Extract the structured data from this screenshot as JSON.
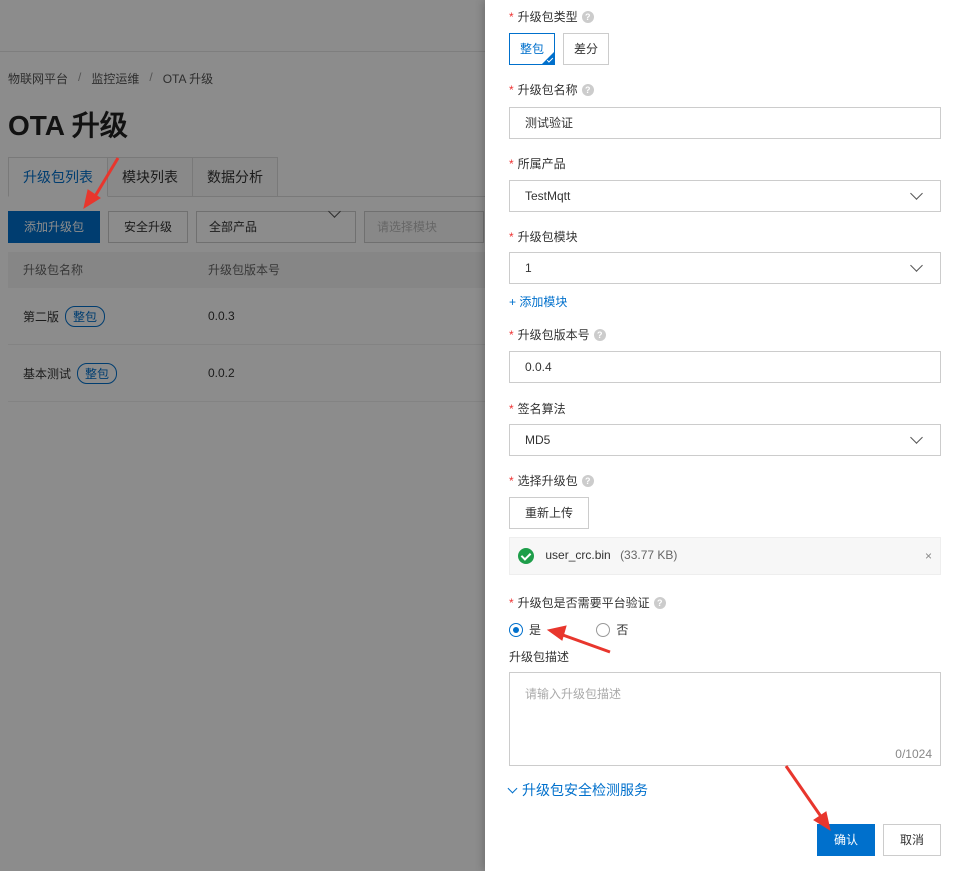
{
  "breadcrumb": [
    "物联网平台",
    "监控运维",
    "OTA 升级"
  ],
  "page_title": "OTA 升级",
  "tabs": [
    "升级包列表",
    "模块列表",
    "数据分析"
  ],
  "toolbar": {
    "add_label": "添加升级包",
    "secure_label": "安全升级",
    "product_select": "全部产品",
    "module_select": "请选择模块"
  },
  "table": {
    "headers": [
      "升级包名称",
      "升级包版本号"
    ],
    "rows": [
      {
        "name": "第二版",
        "tag": "整包",
        "version": "0.0.3"
      },
      {
        "name": "基本测试",
        "tag": "整包",
        "version": "0.0.2"
      }
    ]
  },
  "form": {
    "type": {
      "label": "升级包类型",
      "options": [
        "整包",
        "差分"
      ],
      "selected": "整包"
    },
    "name": {
      "label": "升级包名称",
      "value": "测试验证"
    },
    "product": {
      "label": "所属产品",
      "value": "TestMqtt"
    },
    "module": {
      "label": "升级包模块",
      "value": "1",
      "add_link": "+ 添加模块"
    },
    "version": {
      "label": "升级包版本号",
      "value": "0.0.4"
    },
    "sign": {
      "label": "签名算法",
      "value": "MD5"
    },
    "file": {
      "label": "选择升级包",
      "reupload": "重新上传",
      "filename": "user_crc.bin",
      "filesize": "(33.77 KB)",
      "remove": "×"
    },
    "verify": {
      "label": "升级包是否需要平台验证",
      "yes": "是",
      "no": "否",
      "selected": "是"
    },
    "desc": {
      "label": "升级包描述",
      "placeholder": "请输入升级包描述",
      "counter": "0/1024"
    },
    "security_link": "升级包安全检测服务",
    "confirm": "确认",
    "cancel": "取消"
  },
  "colors": {
    "primary": "#0070cc",
    "required": "#e33",
    "arrow": "#e8362d",
    "success": "#1e9e4a"
  }
}
